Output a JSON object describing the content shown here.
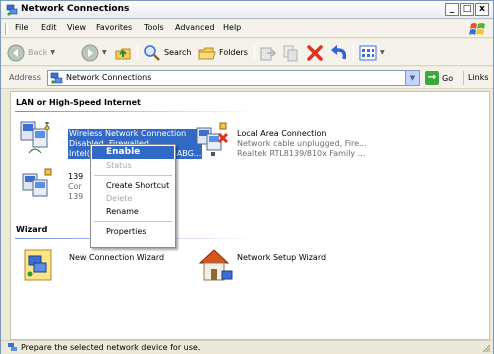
{
  "window": {
    "title": "Network Connections",
    "controls": {
      "minimize": "_",
      "maximize": "□",
      "close": "x"
    }
  },
  "menu": {
    "items": [
      "File",
      "Edit",
      "View",
      "Favorites",
      "Tools",
      "Advanced",
      "Help"
    ]
  },
  "toolbar": {
    "back_label": "Back",
    "search_label": "Search",
    "folders_label": "Folders"
  },
  "address": {
    "label": "Address",
    "value": "Network Connections",
    "go_label": "Go",
    "links_label": "Links"
  },
  "groups": {
    "lan_header": "LAN or High-Speed Internet",
    "wizard_header": "Wizard"
  },
  "connections": {
    "wireless": {
      "name": "Wireless Network Connection",
      "status": "Disabled, Firewalled",
      "device": "Intel(R) PRO/Wireless 3945ABG..."
    },
    "local_area": {
      "name": "Local Area Connection",
      "status": "Network cable unplugged, Fire...",
      "device": "Realtek RTL8139/810x Family ..."
    },
    "third": {
      "name": "139",
      "status": "Cor",
      "device": "139"
    }
  },
  "wizards": {
    "new_connection": "New Connection Wizard",
    "network_setup": "Network Setup Wizard"
  },
  "context_menu": {
    "enable": "Enable",
    "status": "Status",
    "create_shortcut": "Create Shortcut",
    "delete": "Delete",
    "rename": "Rename",
    "properties": "Properties"
  },
  "statusbar": {
    "text": "Prepare the selected network device for use."
  },
  "colors": {
    "selection": "#316ac5",
    "window_bg": "#ece9d8",
    "header_line": "#6f8dd9"
  },
  "icons": {
    "back": "back-arrow-icon",
    "forward": "forward-arrow-icon",
    "up": "up-folder-icon",
    "search": "search-icon",
    "folders": "folders-icon",
    "move_to": "move-to-icon",
    "copy_to": "copy-to-icon",
    "delete": "delete-x-icon",
    "undo": "undo-icon",
    "views": "views-icon"
  }
}
